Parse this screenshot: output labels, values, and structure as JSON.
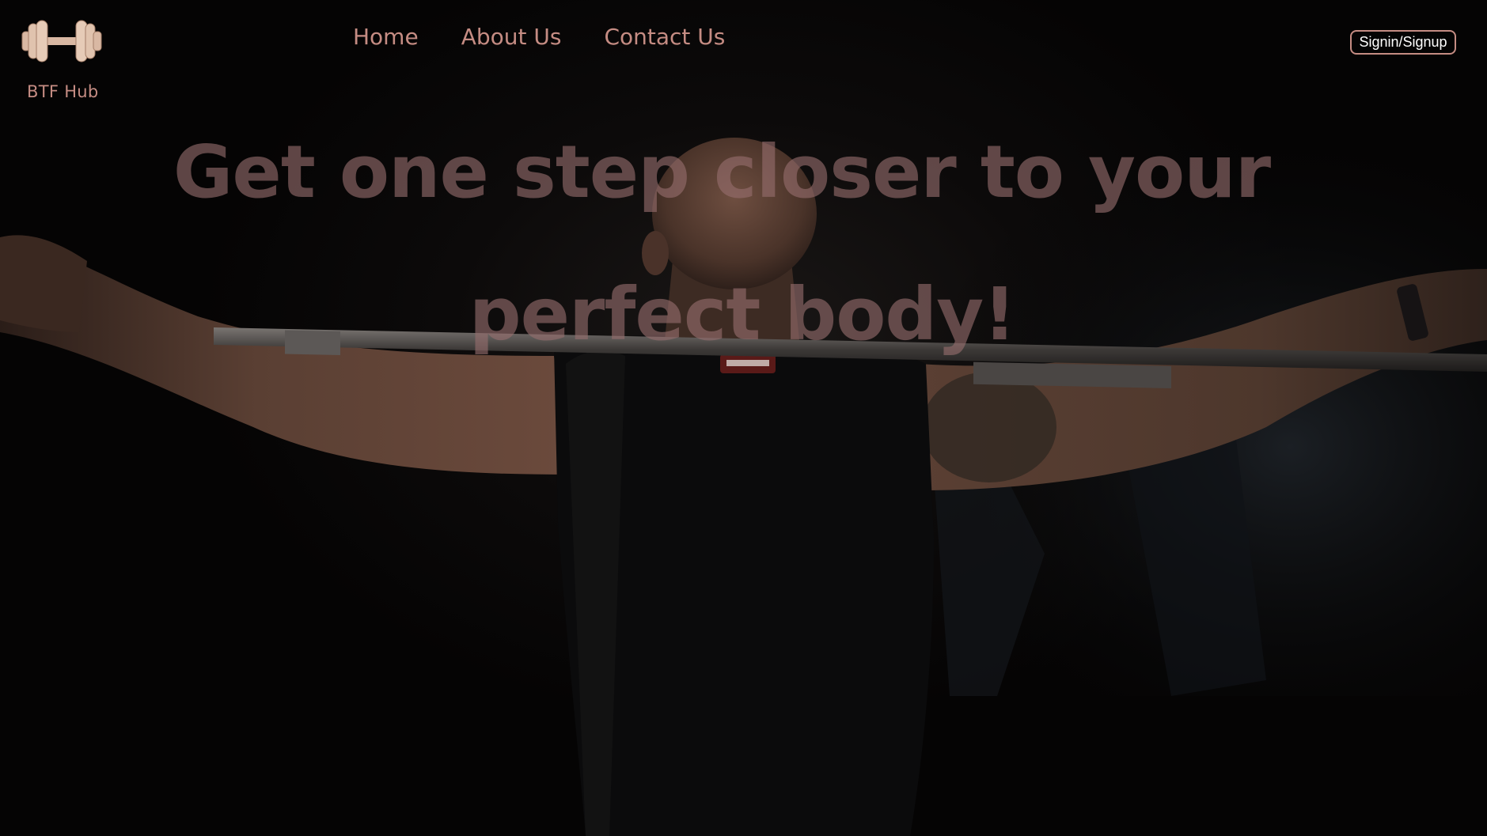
{
  "brand": {
    "name": "BTF Hub",
    "icon": "dumbbell-icon",
    "icon_color": "#d9b8a3"
  },
  "nav": {
    "items": [
      {
        "label": "Home"
      },
      {
        "label": "About Us"
      },
      {
        "label": "Contact Us"
      }
    ]
  },
  "auth": {
    "signin_label": "Signin/Signup"
  },
  "hero": {
    "headline_line1": "Get one step closer to your",
    "headline_line2": "perfect body!",
    "image": "man-holding-barbell-back-view"
  },
  "colors": {
    "accent": "#c58c83",
    "background": "#060505",
    "headline": "#966e6e"
  }
}
